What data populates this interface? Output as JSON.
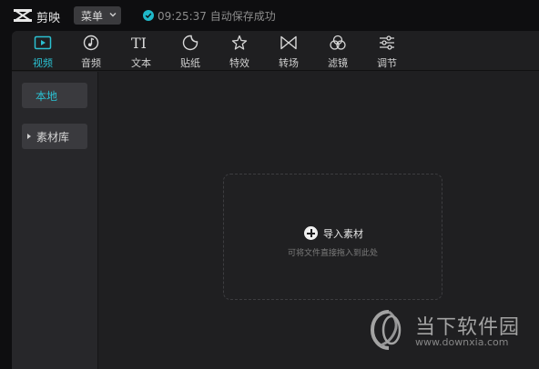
{
  "app": {
    "name": "剪映",
    "menu_label": "菜单"
  },
  "status": {
    "time": "09:25:37",
    "text": "自动保存成功"
  },
  "toolbar": {
    "tabs": [
      {
        "label": "视频",
        "icon": "video-icon",
        "active": true
      },
      {
        "label": "音频",
        "icon": "music-note-icon",
        "active": false
      },
      {
        "label": "文本",
        "icon": "text-icon",
        "active": false
      },
      {
        "label": "贴纸",
        "icon": "sticker-icon",
        "active": false
      },
      {
        "label": "特效",
        "icon": "effects-star-icon",
        "active": false
      },
      {
        "label": "转场",
        "icon": "transition-icon",
        "active": false
      },
      {
        "label": "滤镜",
        "icon": "filter-icon",
        "active": false
      },
      {
        "label": "调节",
        "icon": "adjust-sliders-icon",
        "active": false
      }
    ]
  },
  "sidebar": {
    "local_label": "本地",
    "library_label": "素材库"
  },
  "dropzone": {
    "import_label": "导入素材",
    "hint": "可将文件直接拖入到此处"
  },
  "watermark": {
    "name": "当下软件园",
    "url": "www.downxia.com"
  },
  "colors": {
    "accent": "#2bc0d1",
    "background": "#1f1f21",
    "titlebar": "#0e0e10"
  }
}
